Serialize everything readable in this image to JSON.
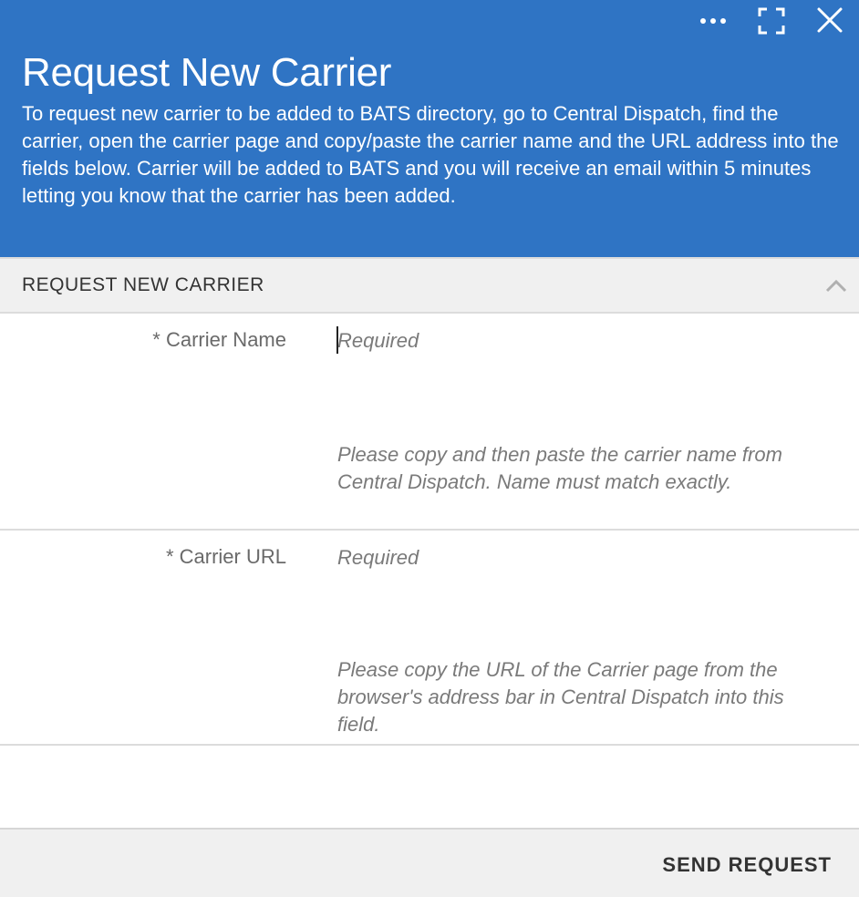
{
  "dialog": {
    "title": "Request New Carrier",
    "description": "To request new carrier to be added to BATS directory, go to Central Dispatch, find the carrier, open the carrier page and copy/paste the carrier name and the URL address into the fields below. Carrier will be added to BATS and you will receive an email within 5 minutes letting you know that the carrier has been added.",
    "header_color": "#2f74c4",
    "controls": {
      "more_icon": "more-horizontal-icon",
      "expand_icon": "fullscreen-icon",
      "close_icon": "close-icon"
    }
  },
  "section": {
    "title": "REQUEST NEW CARRIER",
    "collapse_icon": "chevron-up-icon"
  },
  "fields": {
    "carrier_name": {
      "label": "* Carrier Name",
      "value": "",
      "placeholder": "Required",
      "help": "Please copy and then paste the carrier name from Central Dispatch. Name must match exactly."
    },
    "carrier_url": {
      "label": "* Carrier URL",
      "value": "",
      "placeholder": "Required",
      "help": "Please copy the URL of the Carrier page from the browser's address bar in Central Dispatch into this field."
    }
  },
  "footer": {
    "send_label": "SEND REQUEST"
  }
}
